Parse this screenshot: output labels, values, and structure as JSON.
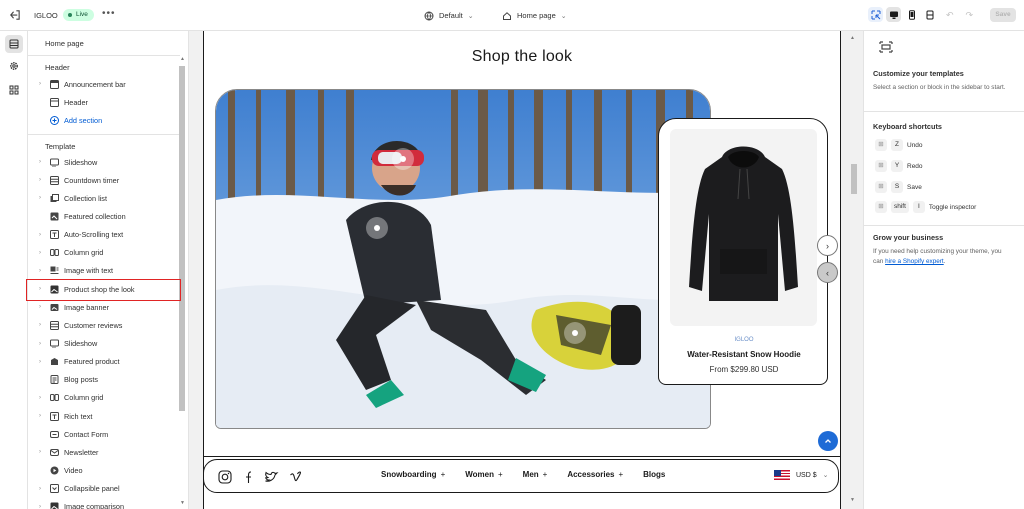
{
  "topbar": {
    "store_name": "IGLOO",
    "status_badge": "Live",
    "more": "•••",
    "theme_label": "Default",
    "page_label": "Home page",
    "save_label": "Save"
  },
  "sidebar": {
    "title": "Home page",
    "header_group": "Header",
    "header_items": [
      {
        "label": "Announcement bar",
        "icon": "layout-top-icon"
      },
      {
        "label": "Header",
        "icon": "layout-header-icon"
      }
    ],
    "add_section": "Add section",
    "template_group": "Template",
    "template_items": [
      {
        "label": "Slideshow",
        "icon": "slideshow-icon"
      },
      {
        "label": "Countdown timer",
        "icon": "section-icon"
      },
      {
        "label": "Collection list",
        "icon": "collection-icon"
      },
      {
        "label": "Featured collection",
        "icon": "featured-collection-icon"
      },
      {
        "label": "Auto-Scrolling text",
        "icon": "text-icon"
      },
      {
        "label": "Column grid",
        "icon": "columns-icon"
      },
      {
        "label": "Image with text",
        "icon": "image-text-icon"
      },
      {
        "label": "Product shop the look",
        "icon": "image-icon"
      },
      {
        "label": "Image banner",
        "icon": "image-banner-icon"
      },
      {
        "label": "Customer reviews",
        "icon": "section-icon"
      },
      {
        "label": "Slideshow",
        "icon": "slideshow-icon"
      },
      {
        "label": "Featured product",
        "icon": "product-icon"
      },
      {
        "label": "Blog posts",
        "icon": "blog-icon"
      },
      {
        "label": "Column grid",
        "icon": "columns-icon"
      },
      {
        "label": "Rich text",
        "icon": "text-icon"
      },
      {
        "label": "Contact Form",
        "icon": "form-icon"
      },
      {
        "label": "Newsletter",
        "icon": "email-icon"
      },
      {
        "label": "Video",
        "icon": "video-icon"
      },
      {
        "label": "Collapsible panel",
        "icon": "collapsible-icon"
      },
      {
        "label": "Image comparison",
        "icon": "image-icon"
      }
    ]
  },
  "preview": {
    "section_title": "Shop the look",
    "product": {
      "brand": "IGLOO",
      "name": "Water-Resistant Snow Hoodie",
      "price": "From $299.80 USD"
    },
    "nav": {
      "items": [
        {
          "label": "Snowboarding",
          "plus": "+"
        },
        {
          "label": "Women",
          "plus": "+"
        },
        {
          "label": "Men",
          "plus": "+"
        },
        {
          "label": "Accessories",
          "plus": "+"
        },
        {
          "label": "Blogs",
          "plus": ""
        }
      ],
      "currency": "USD $"
    }
  },
  "right_panel": {
    "customize_title": "Customize your templates",
    "customize_text": "Select a section or block in the sidebar to start.",
    "shortcuts_title": "Keyboard shortcuts",
    "shortcuts": [
      {
        "keys": [
          "Z"
        ],
        "label": "Undo"
      },
      {
        "keys": [
          "Y"
        ],
        "label": "Redo"
      },
      {
        "keys": [
          "S"
        ],
        "label": "Save"
      },
      {
        "keys": [
          "shift",
          "I"
        ],
        "label": "Toggle inspector"
      }
    ],
    "grow_title": "Grow your business",
    "grow_text": "If you need help customizing your theme, you can ",
    "grow_link": "hire a Shopify expert",
    "grow_end": "."
  },
  "colors": {
    "accent": "#005bd3",
    "highlight": "#e02424",
    "live_bg": "#cdfee1"
  }
}
